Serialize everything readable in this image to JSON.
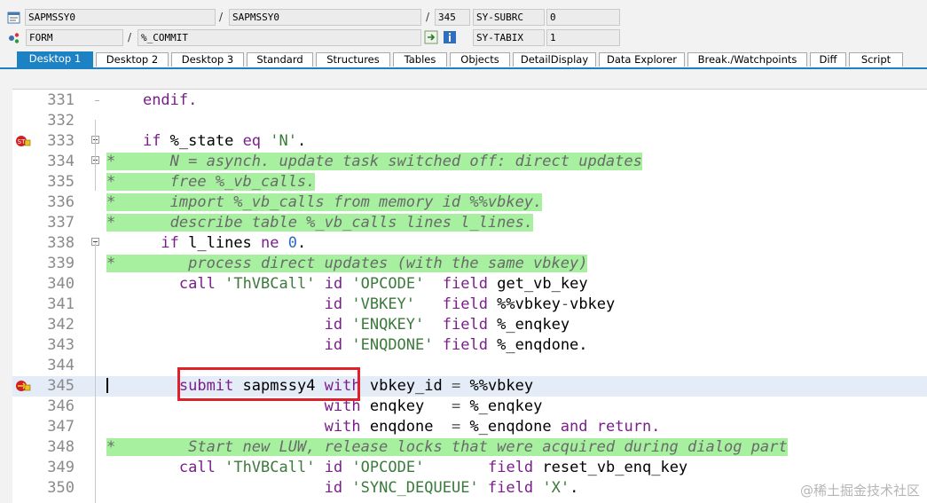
{
  "header": {
    "row1": {
      "program": "SAPMSSY0",
      "include": "SAPMSSY0",
      "line": "345",
      "sysfield1_label": "SY-SUBRC",
      "sysfield1_value": "0"
    },
    "row2": {
      "type": "FORM",
      "name": "%_COMMIT",
      "sysfield2_label": "SY-TABIX",
      "sysfield2_value": "1"
    },
    "separator": "/"
  },
  "tabs": [
    "Desktop 1",
    "Desktop 2",
    "Desktop 3",
    "Standard",
    "Structures",
    "Tables",
    "Objects",
    "DetailDisplay",
    "Data Explorer",
    "Break./Watchpoints",
    "Diff",
    "Script"
  ],
  "code_lines": [
    {
      "n": "331",
      "segs": [
        {
          "t": "    ",
          "c": "txt"
        },
        {
          "t": "endif.",
          "c": "kw"
        }
      ]
    },
    {
      "n": "332",
      "segs": []
    },
    {
      "n": "333",
      "segs": [
        {
          "t": "    ",
          "c": "txt"
        },
        {
          "t": "if",
          "c": "kw"
        },
        {
          "t": " %_state ",
          "c": "txt"
        },
        {
          "t": "eq",
          "c": "kw"
        },
        {
          "t": " ",
          "c": "txt"
        },
        {
          "t": "'N'",
          "c": "str"
        },
        {
          "t": ".",
          "c": "txt"
        }
      ]
    },
    {
      "n": "334",
      "segs": [
        {
          "t": "*      N = asynch. update task switched off: direct updates",
          "c": "comment"
        }
      ]
    },
    {
      "n": "335",
      "segs": [
        {
          "t": "*      free %_vb_calls.",
          "c": "comment"
        }
      ]
    },
    {
      "n": "336",
      "segs": [
        {
          "t": "*      import %_vb_calls from memory id %%vbkey.",
          "c": "comment"
        }
      ]
    },
    {
      "n": "337",
      "segs": [
        {
          "t": "*      describe table %_vb_calls lines l_lines.",
          "c": "comment"
        }
      ]
    },
    {
      "n": "338",
      "segs": [
        {
          "t": "      ",
          "c": "txt"
        },
        {
          "t": "if",
          "c": "kw"
        },
        {
          "t": " l_lines ",
          "c": "txt"
        },
        {
          "t": "ne",
          "c": "kw"
        },
        {
          "t": " ",
          "c": "txt"
        },
        {
          "t": "0",
          "c": "num"
        },
        {
          "t": ".",
          "c": "txt"
        }
      ]
    },
    {
      "n": "339",
      "segs": [
        {
          "t": "*        process direct updates (with the same vbkey)",
          "c": "comment"
        }
      ]
    },
    {
      "n": "340",
      "segs": [
        {
          "t": "        ",
          "c": "txt"
        },
        {
          "t": "call",
          "c": "kw"
        },
        {
          "t": " ",
          "c": "txt"
        },
        {
          "t": "'ThVBCall'",
          "c": "str"
        },
        {
          "t": " ",
          "c": "txt"
        },
        {
          "t": "id",
          "c": "kw"
        },
        {
          "t": " ",
          "c": "txt"
        },
        {
          "t": "'OPCODE'",
          "c": "str"
        },
        {
          "t": "  ",
          "c": "txt"
        },
        {
          "t": "field",
          "c": "kw"
        },
        {
          "t": " get_vb_key",
          "c": "txt"
        }
      ]
    },
    {
      "n": "341",
      "segs": [
        {
          "t": "                        ",
          "c": "txt"
        },
        {
          "t": "id",
          "c": "kw"
        },
        {
          "t": " ",
          "c": "txt"
        },
        {
          "t": "'VBKEY'",
          "c": "str"
        },
        {
          "t": "   ",
          "c": "txt"
        },
        {
          "t": "field",
          "c": "kw"
        },
        {
          "t": " %%vbkey",
          "c": "txt"
        },
        {
          "t": "-",
          "c": "op"
        },
        {
          "t": "vbkey",
          "c": "txt"
        }
      ]
    },
    {
      "n": "342",
      "segs": [
        {
          "t": "                        ",
          "c": "txt"
        },
        {
          "t": "id",
          "c": "kw"
        },
        {
          "t": " ",
          "c": "txt"
        },
        {
          "t": "'ENQKEY'",
          "c": "str"
        },
        {
          "t": "  ",
          "c": "txt"
        },
        {
          "t": "field",
          "c": "kw"
        },
        {
          "t": " %_enqkey",
          "c": "txt"
        }
      ]
    },
    {
      "n": "343",
      "segs": [
        {
          "t": "                        ",
          "c": "txt"
        },
        {
          "t": "id",
          "c": "kw"
        },
        {
          "t": " ",
          "c": "txt"
        },
        {
          "t": "'ENQDONE'",
          "c": "str"
        },
        {
          "t": " ",
          "c": "txt"
        },
        {
          "t": "field",
          "c": "kw"
        },
        {
          "t": " %_enqdone.",
          "c": "txt"
        }
      ]
    },
    {
      "n": "344",
      "segs": []
    },
    {
      "n": "345",
      "segs": [
        {
          "t": "        ",
          "c": "txt"
        },
        {
          "t": "submit",
          "c": "kw"
        },
        {
          "t": " sapmssy4 ",
          "c": "txt"
        },
        {
          "t": "with",
          "c": "kw"
        },
        {
          "t": " vbkey_id ",
          "c": "txt"
        },
        {
          "t": "=",
          "c": "op"
        },
        {
          "t": " %%vbkey",
          "c": "txt"
        }
      ]
    },
    {
      "n": "346",
      "segs": [
        {
          "t": "                        ",
          "c": "txt"
        },
        {
          "t": "with",
          "c": "kw"
        },
        {
          "t": " enqkey   ",
          "c": "txt"
        },
        {
          "t": "=",
          "c": "op"
        },
        {
          "t": " %_enqkey",
          "c": "txt"
        }
      ]
    },
    {
      "n": "347",
      "segs": [
        {
          "t": "                        ",
          "c": "txt"
        },
        {
          "t": "with",
          "c": "kw"
        },
        {
          "t": " enqdone  ",
          "c": "txt"
        },
        {
          "t": "=",
          "c": "op"
        },
        {
          "t": " %_enqdone ",
          "c": "txt"
        },
        {
          "t": "and",
          "c": "kw"
        },
        {
          "t": " ",
          "c": "txt"
        },
        {
          "t": "return.",
          "c": "kw"
        }
      ]
    },
    {
      "n": "348",
      "segs": [
        {
          "t": "*        Start new LUW, release locks that were acquired during dialog part",
          "c": "comment"
        }
      ]
    },
    {
      "n": "349",
      "segs": [
        {
          "t": "        ",
          "c": "txt"
        },
        {
          "t": "call",
          "c": "kw"
        },
        {
          "t": " ",
          "c": "txt"
        },
        {
          "t": "'ThVBCall'",
          "c": "str"
        },
        {
          "t": " ",
          "c": "txt"
        },
        {
          "t": "id",
          "c": "kw"
        },
        {
          "t": " ",
          "c": "txt"
        },
        {
          "t": "'OPCODE'",
          "c": "str"
        },
        {
          "t": "       ",
          "c": "txt"
        },
        {
          "t": "field",
          "c": "kw"
        },
        {
          "t": " reset_vb_enq_key",
          "c": "txt"
        }
      ]
    },
    {
      "n": "350",
      "segs": [
        {
          "t": "                        ",
          "c": "txt"
        },
        {
          "t": "id",
          "c": "kw"
        },
        {
          "t": " ",
          "c": "txt"
        },
        {
          "t": "'SYNC_DEQUEUE'",
          "c": "str"
        },
        {
          "t": " ",
          "c": "txt"
        },
        {
          "t": "field",
          "c": "kw"
        },
        {
          "t": " ",
          "c": "txt"
        },
        {
          "t": "'X'",
          "c": "str"
        },
        {
          "t": ".",
          "c": "txt"
        }
      ]
    }
  ],
  "watermark": "@稀土掘金技术社区"
}
